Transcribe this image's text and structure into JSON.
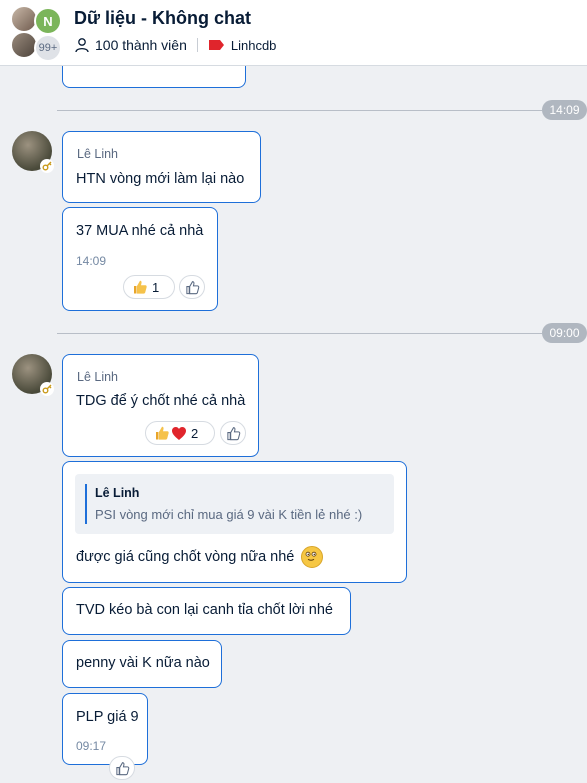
{
  "header": {
    "title": "Dữ liệu - Không chat",
    "avatar_initial": "N",
    "avatar_more": "99+",
    "members": "100 thành viên",
    "tag": "Linhcdb",
    "tag_color": "#e0252c"
  },
  "time_dividers": [
    "14:09",
    "09:00"
  ],
  "messages": [
    {
      "sender": "Lê Linh",
      "text": "HTN vòng mới làm lại nào"
    },
    {
      "text": "37 MUA nhé cả nhà",
      "time": "14:09",
      "reaction_count": "1"
    },
    {
      "sender": "Lê Linh",
      "text": "TDG để ý chốt nhé cả nhà",
      "reaction_count": "2"
    },
    {
      "quote_sender": "Lê Linh",
      "quote_text": "PSI vòng mới chỉ mua giá 9 vài K tiền lẻ nhé :)",
      "text": "được giá cũng chốt vòng nữa nhé"
    },
    {
      "text": "TVD kéo bà con lại canh tỉa chốt lời nhé"
    },
    {
      "text": "penny vài K nữa nào"
    },
    {
      "text": "PLP giá 9",
      "time": "09:17"
    }
  ],
  "colors": {
    "accent": "#1e6fd9",
    "background": "#eef0f3",
    "heart": "#e0252c"
  },
  "icons": [
    "person-icon",
    "tag-icon",
    "thumbs-up-icon",
    "heart-icon",
    "like-outline-icon",
    "smile-emoji-icon"
  ]
}
